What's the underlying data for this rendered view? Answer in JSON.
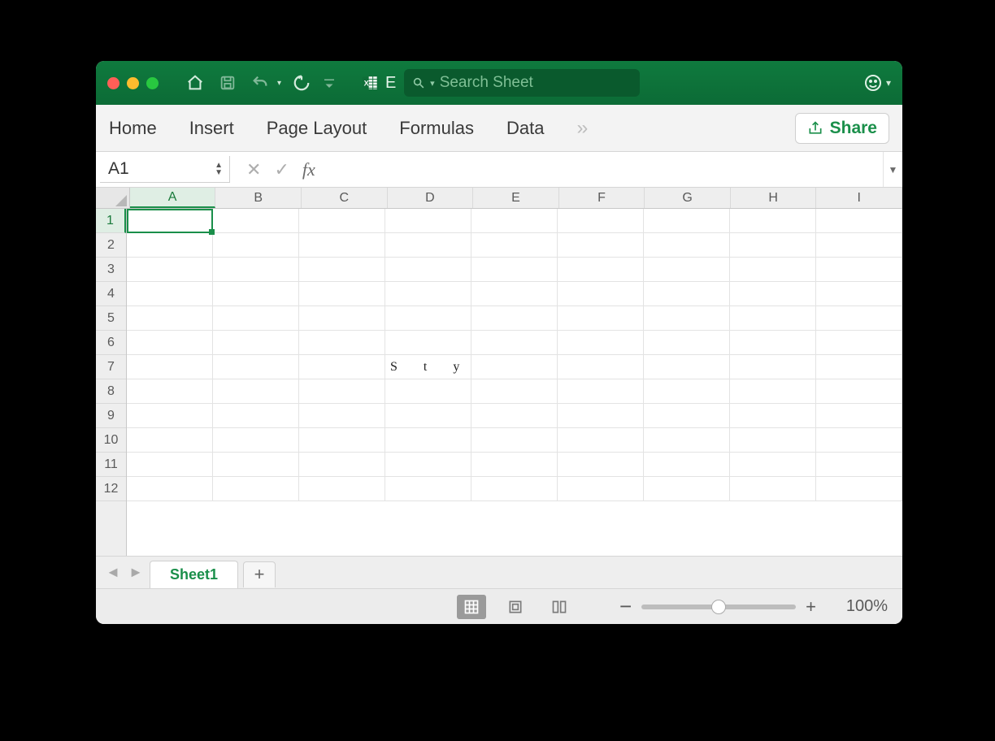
{
  "search": {
    "placeholder": "Search Sheet"
  },
  "app_label": "E",
  "ribbon": {
    "tabs": [
      "Home",
      "Insert",
      "Page Layout",
      "Formulas",
      "Data"
    ],
    "share": "Share"
  },
  "namebox": {
    "value": "A1"
  },
  "formula_bar": {
    "label": "fx",
    "value": ""
  },
  "columns": [
    "A",
    "B",
    "C",
    "D",
    "E",
    "F",
    "G",
    "H",
    "I"
  ],
  "rows": [
    "1",
    "2",
    "3",
    "4",
    "5",
    "6",
    "7",
    "8",
    "9",
    "10",
    "11",
    "12"
  ],
  "active_cell": {
    "col": "A",
    "row": "1"
  },
  "cells": {
    "D7": "S t y l e"
  },
  "sheet_tabs": {
    "active": "Sheet1"
  },
  "status": {
    "zoom_label": "100%"
  }
}
